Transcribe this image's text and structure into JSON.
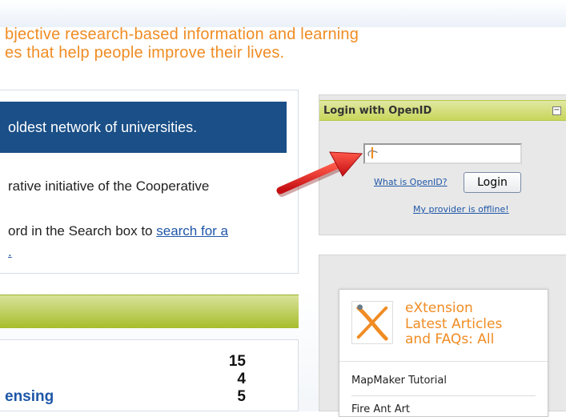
{
  "tagline": {
    "line1": "bjective research-based information and learning",
    "line2": "es that help people improve their lives."
  },
  "main": {
    "banner_text": "oldest network of universities.",
    "line1": "rative initiative of the Cooperative",
    "line2_prefix": "ord in the Search box to ",
    "line2_link": "search for a",
    "line3_link": "."
  },
  "stats": {
    "rows": [
      {
        "label": "",
        "value": "15"
      },
      {
        "label": "",
        "value": "4"
      },
      {
        "label": "ensing",
        "value": "5"
      }
    ]
  },
  "login": {
    "header": "Login with OpenID",
    "collapse_symbol": "−",
    "input_value": "",
    "what_is_link": "What is OpenID?",
    "login_button": "Login",
    "offline_link": "My provider is offline!"
  },
  "extension": {
    "title_line1": "eXtension",
    "title_line2": "Latest Articles",
    "title_line3": "and FAQs: All",
    "items": [
      "MapMaker Tutorial",
      "Fire Ant Art"
    ]
  },
  "colors": {
    "accent_orange": "#f08c23",
    "banner_blue": "#1a4f87",
    "header_green": "#c8d65a",
    "arrow_red": "#e0161b"
  }
}
